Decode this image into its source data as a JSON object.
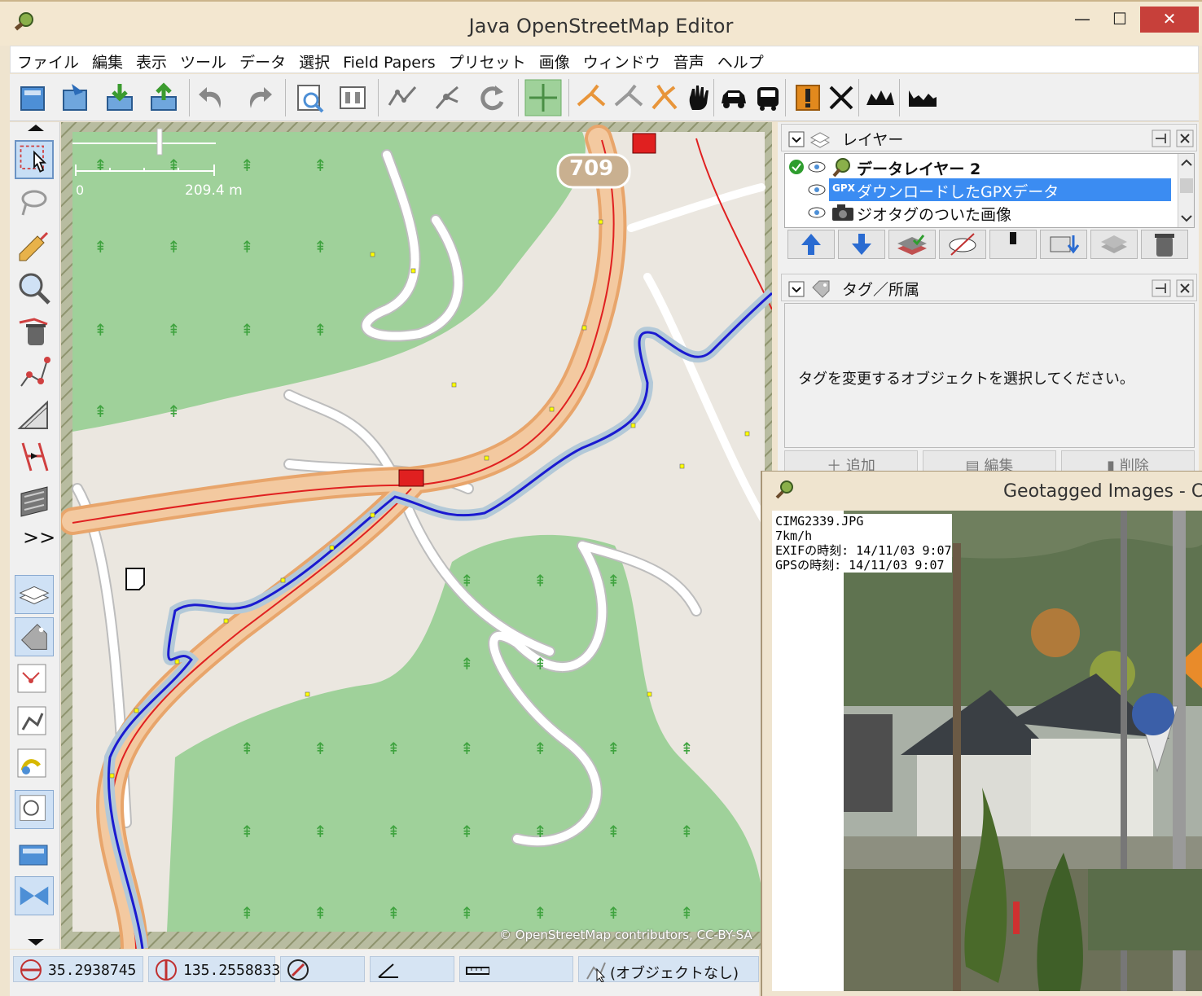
{
  "window": {
    "title": "Java OpenStreetMap Editor",
    "minimize": "—",
    "maximize": "☐",
    "close": "✕"
  },
  "menu": [
    "ファイル",
    "編集",
    "表示",
    "ツール",
    "データ",
    "選択",
    "Field Papers",
    "プリセット",
    "画像",
    "ウィンドウ",
    "音声",
    "ヘルプ"
  ],
  "map": {
    "scale_zero": "0",
    "scale_label": "209.4 m",
    "route_shield": "709",
    "attribution": "© OpenStreetMap contributors, CC-BY-SA"
  },
  "status": {
    "lat": "35.2938745",
    "lon": "135.2558833",
    "heading": "",
    "angle": "",
    "distance": "",
    "selection": "(オブジェクトなし)"
  },
  "layers_panel": {
    "title": "レイヤー",
    "rows": [
      {
        "name": "データレイヤー 2",
        "active": true,
        "selected": false
      },
      {
        "name": "ダウンロードしたGPXデータ",
        "active": false,
        "selected": true,
        "badge": "GPX"
      },
      {
        "name": "ジオタグのついた画像",
        "active": false,
        "selected": false
      }
    ]
  },
  "tags_panel": {
    "title": "タグ／所属",
    "message": "タグを変更するオブジェクトを選択してください。",
    "add": "追加",
    "edit": "編集",
    "delete": "削除"
  },
  "geotagged": {
    "title": "Geotagged Images - C",
    "filename": "CIMG2339.JPG",
    "speed": "7km/h",
    "exif_time": "EXIFの時刻: 14/11/03 9:07",
    "gps_time": "GPSの時刻: 14/11/03 9:07"
  }
}
